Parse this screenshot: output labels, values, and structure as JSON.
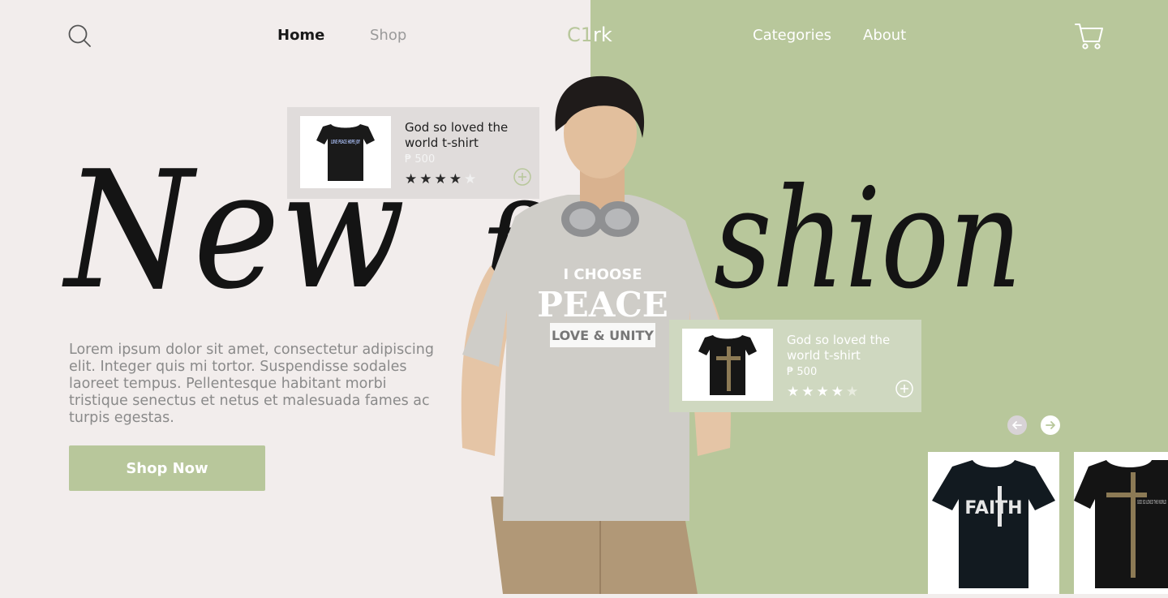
{
  "nav": {
    "home": "Home",
    "shop": "Shop",
    "brand_part1": "C1",
    "brand_part2": "rk",
    "categories": "Categories",
    "about": "About"
  },
  "icons": {
    "search": "search-icon",
    "cart": "cart-icon",
    "add": "plus-circle-icon",
    "prev": "arrow-left-icon",
    "next": "arrow-right-icon"
  },
  "hero": {
    "headline_word1": "New",
    "headline_word2_left": "f",
    "headline_word2_right": "shion",
    "description": "Lorem ipsum dolor sit amet, consectetur adipiscing elit. Integer quis mi tortor. Suspendisse sodales laoreet tempus. Pellentesque habitant morbi tristique senectus et netus et malesuada fames ac turpis egestas.",
    "cta": "Shop Now"
  },
  "products": [
    {
      "title": "God so loved the world t-shirt",
      "price": "₱ 500",
      "rating": 4,
      "max_rating": 5,
      "shirt_print": "LOVE PEACE HOPE JOY"
    },
    {
      "title": "God so loved the world t-shirt",
      "price": "₱ 500",
      "rating": 4,
      "max_rating": 5
    }
  ],
  "carousel": {
    "items": [
      {
        "shirt_print": "FAITH"
      },
      {
        "shirt_print": "GOD SO LOVED THE WORLD"
      }
    ]
  },
  "model_shirt": {
    "line1": "I CHOOSE",
    "line2": "PEACE",
    "line3": "LOVE & UNITY"
  },
  "colors": {
    "left_bg": "#f2edec",
    "right_bg": "#b8c79b",
    "accent": "#b8c79b"
  }
}
